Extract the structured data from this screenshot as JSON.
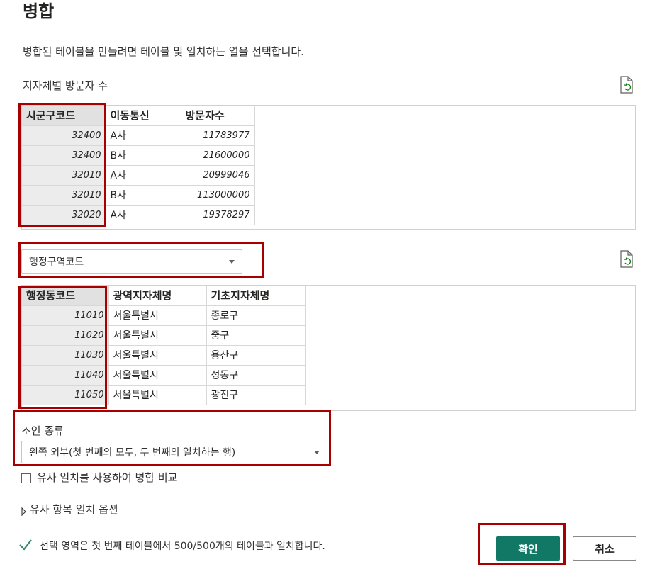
{
  "dialog": {
    "title": "병합",
    "subtitle": "병합된 테이블을 만들려면 테이블 및 일치하는 열을 선택합니다."
  },
  "table1": {
    "label": "지자체별 방문자 수",
    "headers": [
      "시군구코드",
      "이동통신",
      "방문자수"
    ],
    "rows": [
      [
        "32400",
        "A사",
        "11783977"
      ],
      [
        "32400",
        "B사",
        "21600000"
      ],
      [
        "32010",
        "A사",
        "20999046"
      ],
      [
        "32010",
        "B사",
        "113000000"
      ],
      [
        "32020",
        "A사",
        "19378297"
      ]
    ]
  },
  "table2_select": {
    "value": "행정구역코드"
  },
  "table2": {
    "headers": [
      "행정동코드",
      "광역지자체명",
      "기초지자체명"
    ],
    "rows": [
      [
        "11010",
        "서울특별시",
        "종로구"
      ],
      [
        "11020",
        "서울특별시",
        "중구"
      ],
      [
        "11030",
        "서울특별시",
        "용산구"
      ],
      [
        "11040",
        "서울특별시",
        "성동구"
      ],
      [
        "11050",
        "서울특별시",
        "광진구"
      ]
    ]
  },
  "join": {
    "label": "조인 종류",
    "value": "왼쪽 외부(첫 번째의 모두, 두 번째의 일치하는 행)"
  },
  "fuzzy": {
    "checkbox_label": "유사 일치를 사용하여 병합 비교",
    "options_label": "유사 항목 일치 옵션"
  },
  "status": {
    "message": "선택 영역은 첫 번째 테이블에서 500/500개의 테이블과 일치합니다."
  },
  "buttons": {
    "ok": "확인",
    "cancel": "취소"
  },
  "colors": {
    "accent": "#117865",
    "highlight": "#a80000",
    "success": "#107c10"
  }
}
